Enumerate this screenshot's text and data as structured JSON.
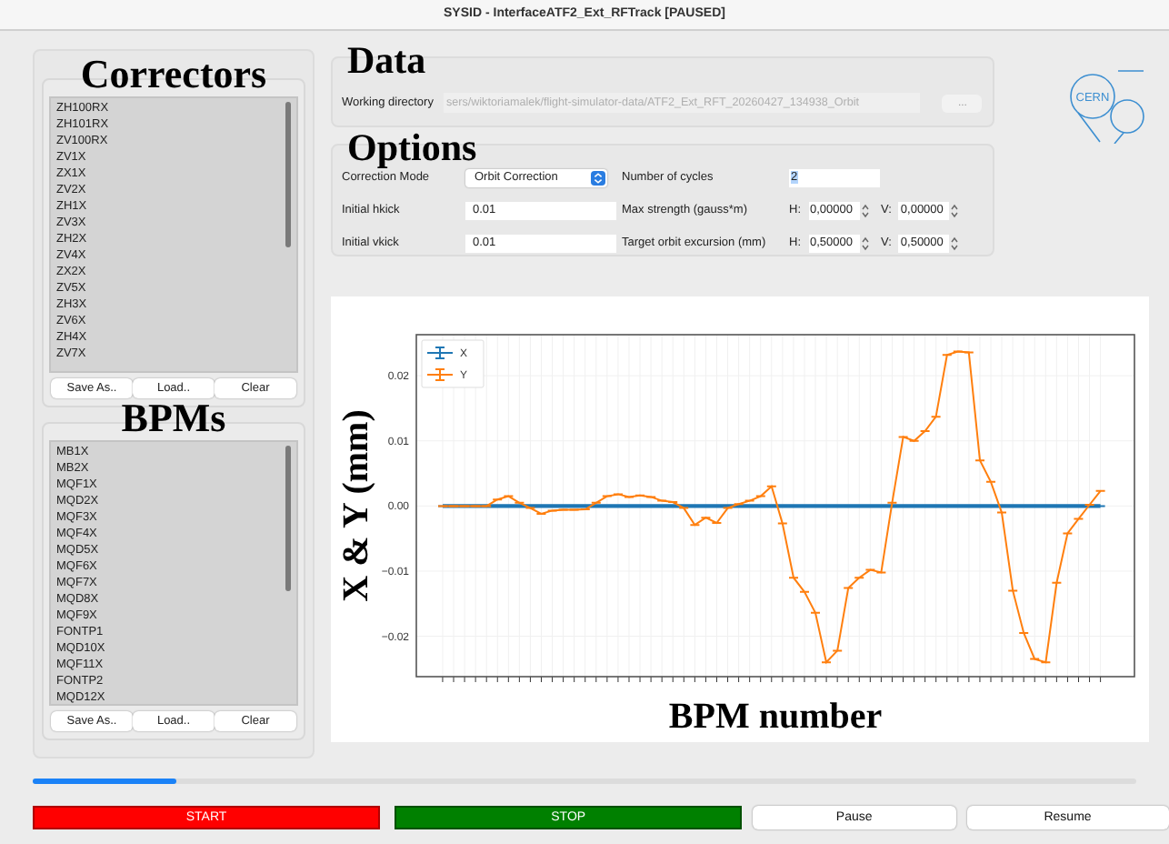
{
  "window": {
    "title": "SYSID - InterfaceATF2_Ext_RFTrack [PAUSED]"
  },
  "correctors": {
    "title": "Correctors",
    "items": [
      "ZH100RX",
      "ZH101RX",
      "ZV100RX",
      "ZV1X",
      "ZX1X",
      "ZV2X",
      "ZH1X",
      "ZV3X",
      "ZH2X",
      "ZV4X",
      "ZX2X",
      "ZV5X",
      "ZH3X",
      "ZV6X",
      "ZH4X",
      "ZV7X"
    ],
    "buttons": [
      "Save As..",
      "Load..",
      "Clear"
    ]
  },
  "bpms": {
    "title": "BPMs",
    "items": [
      "MB1X",
      "MB2X",
      "MQF1X",
      "MQD2X",
      "MQF3X",
      "MQF4X",
      "MQD5X",
      "MQF6X",
      "MQF7X",
      "MQD8X",
      "MQF9X",
      "FONTP1",
      "MQD10X",
      "MQF11X",
      "FONTP2",
      "MQD12X"
    ],
    "buttons": [
      "Save As..",
      "Load..",
      "Clear"
    ]
  },
  "data": {
    "title": "Data",
    "working_directory": {
      "label": "Working directory",
      "value": "sers/wiktoriamalek/flight-simulator-data/ATF2_Ext_RFT_20260427_134938_Orbit",
      "disabled": true
    },
    "browse_button": "..."
  },
  "options": {
    "title": "Options",
    "correction_mode": {
      "label": "Correction Mode",
      "value": "Orbit Correction"
    },
    "number_of_cycles": {
      "label": "Number of cycles",
      "value": "2"
    },
    "initial_hkick": {
      "label": "Initial hkick",
      "value": "0.01"
    },
    "initial_vkick": {
      "label": "Initial vkick",
      "value": "0.01"
    },
    "max_strength": {
      "label": "Max strength (gauss*m)",
      "h_label": "H:",
      "h_value": "0,00000",
      "v_label": "V:",
      "v_value": "0,00000"
    },
    "target_orbit_excursion": {
      "label": "Target orbit excursion (mm)",
      "h_label": "H:",
      "h_value": "0,50000",
      "v_label": "V:",
      "v_value": "0,50000"
    }
  },
  "logo": {
    "text": "CERN"
  },
  "chart_data": {
    "type": "line",
    "xlabel": "BPM number",
    "ylabel": "X & Y (mm)",
    "categories": [
      null,
      null,
      null,
      null,
      null,
      null,
      null,
      null,
      null,
      null,
      null,
      null,
      null,
      null,
      null,
      null,
      null,
      null,
      null,
      null,
      null,
      null,
      null,
      null,
      null,
      null,
      null,
      null,
      null,
      null,
      null,
      null,
      null,
      null,
      null,
      null,
      null,
      null,
      null,
      null,
      null,
      null,
      null,
      null,
      null,
      null,
      null,
      null,
      null,
      null,
      null,
      null,
      null,
      null,
      null,
      null,
      null,
      null,
      null,
      null,
      null
    ],
    "ylim": [
      -0.0262,
      0.0263
    ],
    "grid": true,
    "legend": true,
    "yticks": [
      {
        "value": -0.02,
        "label": "−0.02"
      },
      {
        "value": -0.01,
        "label": "−0.01"
      },
      {
        "value": 0,
        "label": "0.00"
      },
      {
        "value": 0.01,
        "label": "0.01"
      },
      {
        "value": 0.02,
        "label": "0.02"
      }
    ],
    "series": [
      {
        "name": "X",
        "color": "#1f77b4",
        "values": [
          0,
          0,
          0,
          0,
          0,
          0,
          0,
          0,
          0,
          0,
          0,
          0,
          0,
          0,
          0,
          0,
          0,
          0,
          0,
          0,
          0,
          0,
          0,
          0,
          0,
          0,
          0,
          0,
          0,
          0,
          0,
          0,
          0,
          0,
          0,
          0,
          0,
          0,
          0,
          0,
          0,
          0,
          0,
          0,
          0,
          0,
          0,
          0,
          0,
          0,
          0,
          0,
          0,
          0,
          0,
          0,
          0,
          0,
          0,
          0,
          0
        ],
        "errors": [
          0,
          0,
          0,
          0,
          0,
          0,
          0,
          0,
          0,
          0,
          0,
          0,
          0,
          0,
          0,
          0,
          0,
          0,
          0,
          0,
          0,
          0,
          0,
          0,
          0,
          0,
          0,
          0,
          0,
          0,
          0,
          0,
          0,
          0,
          0,
          0,
          0,
          0,
          0,
          0,
          0,
          0,
          0,
          0,
          0,
          0,
          0,
          0,
          0,
          0,
          0,
          0,
          0,
          0,
          0,
          0,
          0,
          0,
          0,
          0,
          0
        ]
      },
      {
        "name": "Y",
        "color": "#ff7f0e",
        "values": [
          0,
          0,
          0,
          0,
          0,
          0.001,
          0.0015,
          0.0005,
          -0.0003,
          -0.0012,
          -0.0007,
          -0.0006,
          -0.0006,
          -0.0005,
          0.0005,
          0.0015,
          0.0018,
          0.0014,
          0.0016,
          0.0014,
          0.0008,
          0.0006,
          -0.0003,
          -0.0029,
          -0.0018,
          -0.0026,
          -0.0003,
          0.0003,
          0.0008,
          0.0015,
          0.003,
          -0.0027,
          -0.011,
          -0.0132,
          -0.0164,
          -0.024,
          -0.0222,
          -0.0126,
          -0.011,
          -0.0098,
          -0.0102,
          0.0005,
          0.0106,
          0.01,
          0.0115,
          0.0137,
          0.0232,
          0.0237,
          0.0236,
          0.007,
          0.0037,
          -0.001,
          -0.013,
          -0.0195,
          -0.0235,
          -0.024,
          -0.0118,
          -0.0042,
          -0.002,
          0.0002,
          0.0023
        ],
        "errors": [
          0,
          0,
          0,
          0,
          0,
          0,
          0,
          0,
          0,
          0,
          0,
          0,
          0,
          0,
          0,
          0,
          0,
          0,
          0,
          0,
          0,
          0,
          0,
          0,
          0,
          0,
          0,
          0,
          0,
          0,
          0,
          0,
          0,
          0,
          0,
          0,
          0,
          0,
          0,
          0,
          0,
          0,
          0,
          0,
          0,
          0,
          0,
          0,
          0,
          0,
          0,
          0,
          0,
          0,
          0,
          0,
          0,
          0,
          0,
          0,
          0
        ]
      }
    ]
  },
  "progress": {
    "level": 0.13
  },
  "buttons": [
    {
      "label": "START",
      "kind": "start"
    },
    {
      "label": "STOP",
      "kind": "stop"
    },
    {
      "label": "Pause",
      "kind": "plain"
    },
    {
      "label": "Resume",
      "kind": "plain"
    }
  ]
}
